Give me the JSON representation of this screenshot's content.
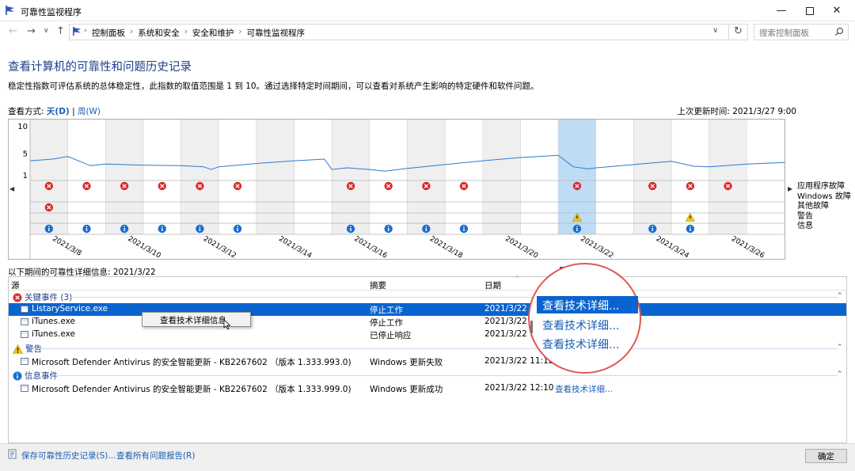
{
  "window": {
    "title": "可靠性监视程序"
  },
  "nav": {
    "breadcrumbs": [
      "控制面板",
      "系统和安全",
      "安全和维护",
      "可靠性监视程序"
    ],
    "search_placeholder": "搜索控制面板"
  },
  "header": {
    "title": "查看计算机的可靠性和问题历史记录",
    "description": "稳定性指数可评估系统的总体稳定性，此指数的取值范围是 1 到 10。通过选择特定时间期间，可以查看对系统产生影响的特定硬件和软件问题。",
    "view_by_label": "查看方式:",
    "view_day": "天(D)",
    "view_sep": "|",
    "view_week": "周(W)",
    "last_updated": "上次更新时间: 2021/3/27 9:00"
  },
  "chart_data": {
    "type": "line",
    "y_ticks": [
      "10",
      "5",
      "1"
    ],
    "ylim": [
      1,
      10
    ],
    "x_labels": [
      "2021/3/8",
      "2021/3/10",
      "2021/3/12",
      "2021/3/14",
      "2021/3/16",
      "2021/3/18",
      "2021/3/20",
      "2021/3/22",
      "2021/3/24",
      "2021/3/26"
    ],
    "days": 20,
    "selected_day_index": 14,
    "stability_series": [
      [
        0,
        3.6
      ],
      [
        0.6,
        3.9
      ],
      [
        1.0,
        4.4
      ],
      [
        1.6,
        2.7
      ],
      [
        2.0,
        3.0
      ],
      [
        3.0,
        2.8
      ],
      [
        4.0,
        2.7
      ],
      [
        4.6,
        2.5
      ],
      [
        4.8,
        2.0
      ],
      [
        5.0,
        2.5
      ],
      [
        6.0,
        3.1
      ],
      [
        7.0,
        3.6
      ],
      [
        7.8,
        3.9
      ],
      [
        8.0,
        2.0
      ],
      [
        8.4,
        2.3
      ],
      [
        9.0,
        2.0
      ],
      [
        9.4,
        1.7
      ],
      [
        10.0,
        2.2
      ],
      [
        11.0,
        2.9
      ],
      [
        12.0,
        3.6
      ],
      [
        13.0,
        4.2
      ],
      [
        14.0,
        4.6
      ],
      [
        14.4,
        2.5
      ],
      [
        14.8,
        2.1
      ],
      [
        15.0,
        2.3
      ],
      [
        16.0,
        2.9
      ],
      [
        17.0,
        3.5
      ],
      [
        17.6,
        2.6
      ],
      [
        18.0,
        2.5
      ],
      [
        19.0,
        3.0
      ],
      [
        20.0,
        3.3
      ]
    ],
    "rows": [
      "应用程序故障",
      "Windows 故障",
      "其他故障",
      "警告",
      "信息"
    ],
    "app_failures": [
      0,
      1,
      2,
      3,
      4,
      5,
      8,
      9,
      10,
      11,
      14,
      16,
      17,
      18
    ],
    "other_failures": [
      0
    ],
    "warnings": [
      14,
      17
    ],
    "info": [
      0,
      1,
      2,
      3,
      4,
      5,
      8,
      9,
      10,
      11,
      14,
      16,
      17
    ]
  },
  "details": {
    "label": "以下期间的可靠性详细信息: 2021/3/22",
    "columns": {
      "source": "源",
      "summary": "摘要",
      "date": "日期",
      "action": "操作",
      "f_fragment": "F"
    },
    "groups": {
      "critical": "关键事件 (3)",
      "warning": "警告",
      "info": "信息事件"
    },
    "critical_rows": [
      {
        "source": "ListaryService.exe",
        "summary": "停止工作",
        "date": "2021/3/22 1"
      },
      {
        "source": "iTunes.exe",
        "summary": "停止工作",
        "date": "2021/3/22"
      },
      {
        "source": "iTunes.exe",
        "summary": "已停止响应",
        "date": "2021/3/22 1"
      }
    ],
    "warning_rows": [
      {
        "source": "Microsoft Defender Antivirus 的安全智能更新 - KB2267602 （版本 1.333.993.0)",
        "summary": "Windows 更新失败",
        "date": "2021/3/22 11:12"
      }
    ],
    "info_rows": [
      {
        "source": "Microsoft Defender Antivirus 的安全智能更新 - KB2267602 （版本 1.333.999.0)",
        "summary": "Windows 更新成功",
        "date": "2021/3/22 12:10",
        "action": "查看技术详细..."
      }
    ],
    "context_menu_item": "查看技术详细信息",
    "zoom_links": [
      "查看技术详细...",
      "查看技术详细...",
      "查看技术详细..."
    ]
  },
  "footer": {
    "save_link": "保存可靠性历史记录(S)...",
    "all_reports_link": "查看所有问题报告(R)",
    "ok_button": "确定"
  }
}
